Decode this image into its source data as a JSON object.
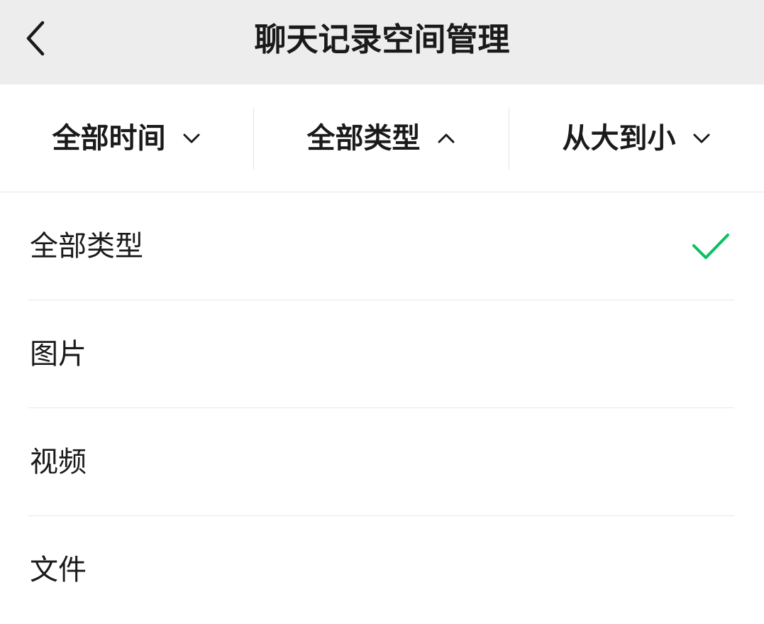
{
  "header": {
    "title": "聊天记录空间管理",
    "back_icon": "chevron-left-icon"
  },
  "filters": [
    {
      "label": "全部时间",
      "chevron": "chevron-down-icon",
      "expanded": false
    },
    {
      "label": "全部类型",
      "chevron": "chevron-up-icon",
      "expanded": true
    },
    {
      "label": "从大到小",
      "chevron": "chevron-down-icon",
      "expanded": false
    }
  ],
  "type_menu": {
    "selected_index": 0,
    "items": [
      {
        "label": "全部类型",
        "selected": true
      },
      {
        "label": "图片",
        "selected": false
      },
      {
        "label": "视频",
        "selected": false
      },
      {
        "label": "文件",
        "selected": false
      }
    ]
  },
  "colors": {
    "header_bg": "#ededed",
    "accent_check": "#07c160",
    "divider": "#e5e5e5",
    "text": "#1a1a1a"
  }
}
